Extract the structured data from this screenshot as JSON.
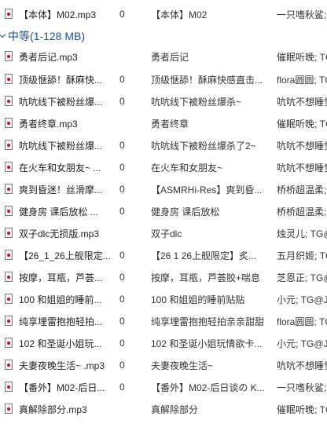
{
  "group": {
    "label": "中等(1-128 MB)"
  },
  "top_row": {
    "name": "【本体】M02.mp3",
    "num": "0",
    "title": "【本体】M02",
    "artist": "一只嗜秋鲨;"
  },
  "rows": [
    {
      "name": "勇者后记.mp3",
      "num": "",
      "title": "勇者后记",
      "artist": "催眠听晚; TG"
    },
    {
      "name": "顶级惬舔！酥麻快...",
      "num": "0",
      "title": "顶级惬舔！酥麻快感直击...",
      "artist": "flora圆圆; TG"
    },
    {
      "name": "吭吭线下被粉丝爆...",
      "num": "0",
      "title": "吭吭线下被粉丝爆杀~",
      "artist": "吭吭不想睡觉"
    },
    {
      "name": "勇者终章.mp3",
      "num": "",
      "title": "勇者终章",
      "artist": "催眠听晚; TG"
    },
    {
      "name": "吭吭线下被粉丝爆...",
      "num": "0",
      "title": "吭吭线下被粉丝爆杀了2~",
      "artist": "吭吭不想睡觉"
    },
    {
      "name": "在火车和女朋友~ ...",
      "num": "0",
      "title": "在火车和女朋友~",
      "artist": "吭吭不想睡觉"
    },
    {
      "name": "爽到昏迷！丝滑摩...",
      "num": "0",
      "title": "【ASMRHi-Res】爽到昏...",
      "artist": "桥桥超温柔;"
    },
    {
      "name": "健身房 课后放松 ...",
      "num": "0",
      "title": "健身房 课后放松",
      "artist": "桥桥超温柔;"
    },
    {
      "name": "双子dlc无损版.mp3",
      "num": "",
      "title": "双子dlc",
      "artist": "烛灵儿; TG@"
    },
    {
      "name": "【26_1_26上舰限定...",
      "num": "0",
      "title": "【26 1 26上舰限定】炙...",
      "artist": "五月织姬; TG"
    },
    {
      "name": "按摩，耳瓶，芦荟...",
      "num": "0",
      "title": "按摩，耳瓶，芦荟胶+喘息",
      "artist": "芝恩正; TG@"
    },
    {
      "name": "100 和姐姐的睡前...",
      "num": "0",
      "title": "100 和姐姐的睡前贴贴",
      "artist": "小元; TG@J"
    },
    {
      "name": "纯享埋雷抱抱轻拍...",
      "num": "0",
      "title": "纯享埋雷抱抱轻拍亲亲甜甜",
      "artist": "flora圆圆; TG"
    },
    {
      "name": "102 和圣诞小姐玩...",
      "num": "0",
      "title": "102 和圣诞小姐玩情欲卡...",
      "artist": "小元; TG@J"
    },
    {
      "name": "夫妻夜晚生活~ .mp3",
      "num": "0",
      "title": "夫妻夜晚生活~",
      "artist": "吭吭不想睡觉"
    },
    {
      "name": "【番外】M02-后日...",
      "num": "0",
      "title": "【番外】M02-后日谈の K...",
      "artist": "一只嗜秋鲨;"
    },
    {
      "name": "真解除部分.mp3",
      "num": "",
      "title": "真解除部分",
      "artist": "催眠听晚; TG"
    }
  ]
}
